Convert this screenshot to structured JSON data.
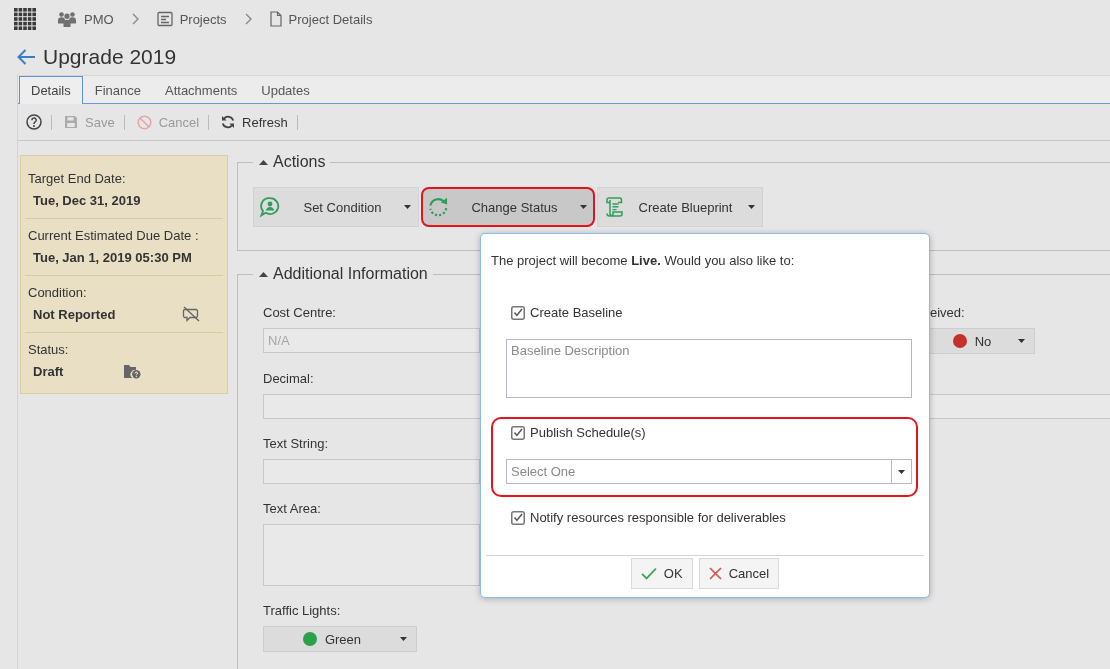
{
  "breadcrumb": [
    {
      "kind": "group",
      "label": "PMO"
    },
    {
      "kind": "list",
      "label": "Projects"
    },
    {
      "kind": "page",
      "label": "Project Details"
    }
  ],
  "title": "Upgrade 2019",
  "tabs": [
    {
      "label": "Details",
      "selected": true
    },
    {
      "label": "Finance",
      "selected": false
    },
    {
      "label": "Attachments",
      "selected": false
    },
    {
      "label": "Updates",
      "selected": false
    }
  ],
  "toolbar": [
    {
      "kind": "help",
      "disabled": false
    },
    {
      "kind": "save",
      "label": "Save",
      "disabled": true
    },
    {
      "kind": "cancel",
      "label": "Cancel",
      "disabled": true
    },
    {
      "kind": "refresh",
      "label": "Refresh",
      "disabled": false
    }
  ],
  "summary": [
    {
      "kind": "date",
      "label": "Target End Date:",
      "value": "Tue, Dec 31, 2019"
    },
    {
      "kind": "date",
      "label": "Current Estimated Due Date :",
      "value": "Tue, Jan 1, 2019 05:30 PM"
    },
    {
      "kind": "condition",
      "label": "Condition:",
      "value": "Not Reported"
    },
    {
      "kind": "status",
      "label": "Status:",
      "value": "Draft"
    }
  ],
  "actions": {
    "title": "Actions",
    "expanded": true,
    "buttons": [
      {
        "kind": "condition",
        "label": "Set Condition",
        "active": false,
        "highlighted": false
      },
      {
        "kind": "status",
        "label": "Change Status",
        "active": true,
        "highlighted": true
      },
      {
        "kind": "blueprint",
        "label": "Create Blueprint",
        "active": false,
        "highlighted": false
      }
    ]
  },
  "additional_information": {
    "title": "Additional Information",
    "expanded": true,
    "rows": [
      [
        {
          "kind": "input",
          "label": "Cost Centre:",
          "placeholder": "N/A",
          "full_width": false
        },
        {
          "kind": "select",
          "label": "eived:",
          "value": "No",
          "color": "#c4302b"
        }
      ],
      [
        {
          "kind": "input",
          "label": "Decimal:",
          "full_width": true
        }
      ],
      [
        {
          "kind": "input",
          "label": "Text String:",
          "full_width": false
        }
      ],
      [
        {
          "kind": "textarea",
          "label": "Text Area:"
        }
      ],
      [
        {
          "kind": "select",
          "label": "Traffic Lights:",
          "value": "Green",
          "color": "#2aa14a"
        }
      ]
    ]
  },
  "dialog": {
    "message": "The project will become **Live.** Would you also like to:",
    "items": [
      {
        "kind": "checkbox",
        "label": "Create Baseline",
        "checked": true
      },
      {
        "kind": "textarea",
        "placeholder": "Baseline Description"
      },
      {
        "kind": "group",
        "highlighted": true,
        "items": [
          {
            "kind": "checkbox",
            "label": "Publish Schedule(s)",
            "checked": true
          },
          {
            "kind": "select",
            "placeholder": "Select One"
          }
        ]
      },
      {
        "kind": "checkbox",
        "label": "Notify resources responsible for deliverables",
        "checked": true
      }
    ],
    "buttons": [
      {
        "kind": "ok",
        "label": "OK"
      },
      {
        "kind": "cancel",
        "label": "Cancel"
      }
    ]
  }
}
